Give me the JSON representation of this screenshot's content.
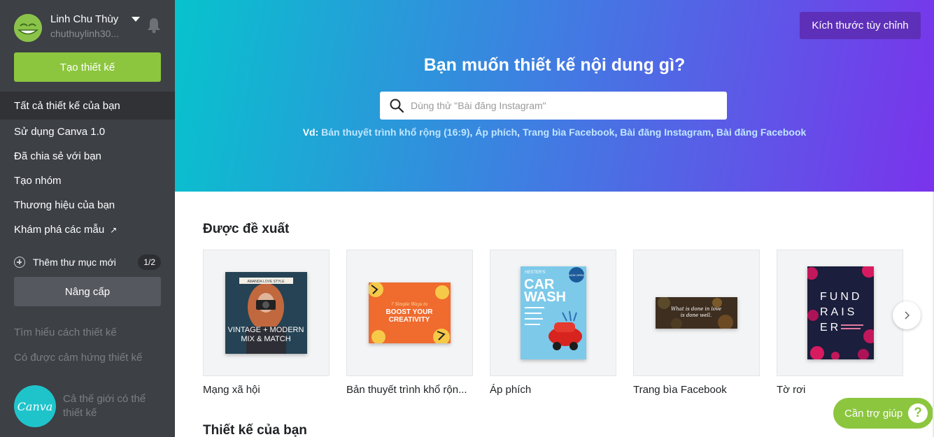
{
  "user": {
    "name": "Linh Chu Thùy",
    "email": "chuthuylinh30..."
  },
  "sidebar": {
    "create_button": "Tạo thiết kế",
    "nav": [
      {
        "label": "Tất cả thiết kế của bạn",
        "active": true
      },
      {
        "label": "Sử dụng Canva 1.0"
      },
      {
        "label": "Đã chia sẻ với bạn"
      },
      {
        "label": "Tạo nhóm"
      },
      {
        "label": "Thương hiệu của bạn"
      },
      {
        "label": "Khám phá các mẫu",
        "icon": "external-link-icon"
      }
    ],
    "add_folder": "Thêm thư mục mới",
    "folder_count": "1/2",
    "upgrade_button": "Nâng cấp",
    "links": [
      "Tìm hiểu cách thiết kế",
      "Có được cảm hứng thiết kế"
    ],
    "logo_text": "Canva",
    "tagline": "Cả thế giới có thể thiết kế"
  },
  "hero": {
    "custom_size_button": "Kích thước tùy chỉnh",
    "title": "Bạn muốn thiết kế nội dung gì?",
    "search_placeholder": "Dùng thử \"Bài đăng Instagram\"",
    "examples_label": "Vd:",
    "examples": [
      "Bản thuyết trình khổ rộng (16:9)",
      "Áp phích",
      "Trang bìa Facebook",
      "Bài đăng Instagram",
      "Bài đăng Facebook"
    ],
    "gradient_colors": [
      "#07c3cd",
      "#3f7ee2",
      "#7a33ec"
    ]
  },
  "suggested": {
    "title": "Được đề xuất",
    "cards": [
      {
        "label": "Mạng xã hội",
        "thumb_lines": [
          "AMANDA LOVE STYLE",
          "VINTAGE + MODERN",
          "MIX & MATCH"
        ]
      },
      {
        "label": "Bản thuyết trình khổ rộn...",
        "thumb_lines": [
          "7 Simple Ways to",
          "BOOST YOUR",
          "CREATIVITY"
        ]
      },
      {
        "label": "Áp phích",
        "thumb_lines": [
          "HESTER'S",
          "NOW OPEN",
          "CAR",
          "WASH"
        ]
      },
      {
        "label": "Trang bìa Facebook",
        "thumb_lines": [
          "What is done in love",
          "is done well."
        ]
      },
      {
        "label": "Tờ rơi",
        "thumb_lines": [
          "FUND",
          "RAIS",
          "ER"
        ]
      }
    ]
  },
  "your_designs": {
    "title": "Thiết kế của bạn"
  },
  "help": {
    "label": "Cần trợ giúp",
    "icon": "?"
  },
  "colors": {
    "sidebar_bg": "#3d4045",
    "primary_green": "#8cc63f",
    "purple_button": "#5e2fb9"
  }
}
